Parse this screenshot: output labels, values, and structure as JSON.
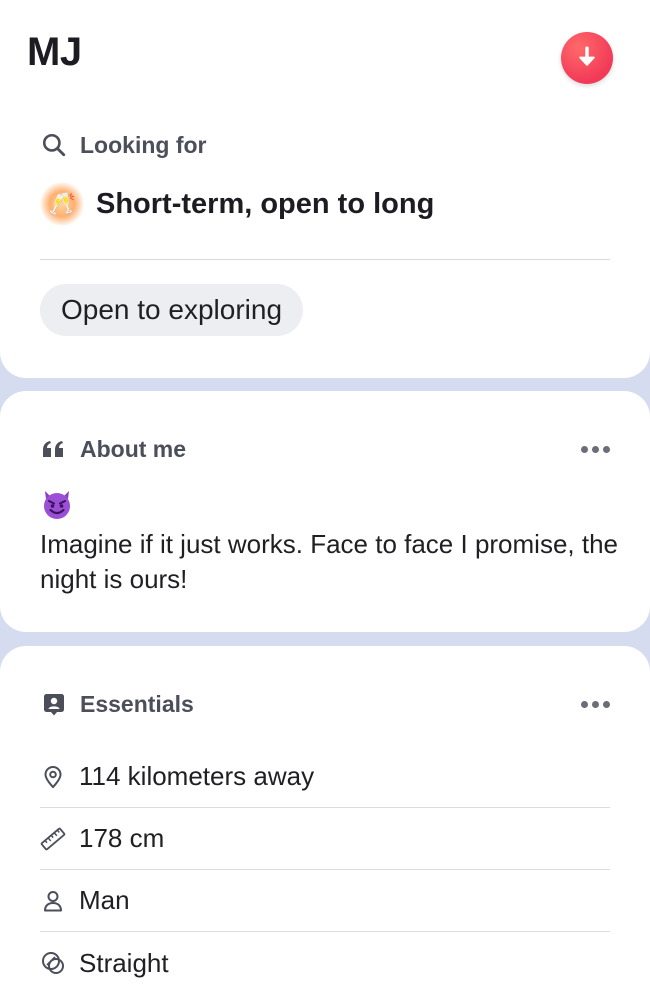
{
  "header": {
    "name": "MJ",
    "download_icon": "arrow-down-icon",
    "accent": "#f23a58"
  },
  "looking_for": {
    "heading": "Looking for",
    "icon": "search-icon",
    "emoji": "🥂",
    "value": "Short-term, open to long",
    "tag": "Open to exploring"
  },
  "about": {
    "heading": "About me",
    "icon": "quote-icon",
    "emoji": "😈",
    "text": "Imagine if it just works. Face to face I promise, the night is ours!"
  },
  "essentials": {
    "heading": "Essentials",
    "icon": "profile-card-icon",
    "items": [
      {
        "icon": "location-pin-icon",
        "label": "114 kilometers away"
      },
      {
        "icon": "ruler-icon",
        "label": "178 cm"
      },
      {
        "icon": "person-icon",
        "label": "Man"
      },
      {
        "icon": "orientation-icon",
        "label": "Straight"
      }
    ]
  },
  "colors": {
    "background": "#d6dcf0",
    "card": "#ffffff",
    "pill": "#eceef2"
  }
}
